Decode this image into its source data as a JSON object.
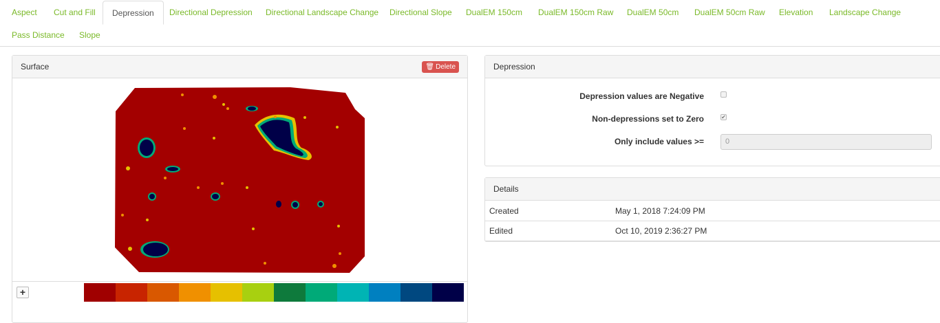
{
  "tabs": [
    {
      "label": "Aspect",
      "active": false
    },
    {
      "label": "Cut and Fill",
      "active": false
    },
    {
      "label": "Depression",
      "active": true
    },
    {
      "label": "Directional Depression",
      "active": false
    },
    {
      "label": "Directional Landscape Change",
      "active": false
    },
    {
      "label": "Directional Slope",
      "active": false
    },
    {
      "label": "DualEM 150cm",
      "active": false
    },
    {
      "label": "DualEM 150cm Raw",
      "active": false
    },
    {
      "label": "DualEM 50cm",
      "active": false
    },
    {
      "label": "DualEM 50cm Raw",
      "active": false
    },
    {
      "label": "Elevation",
      "active": false
    },
    {
      "label": "Landscape Change",
      "active": false
    },
    {
      "label": "Pass Distance",
      "active": false
    },
    {
      "label": "Slope",
      "active": false
    }
  ],
  "surface_panel": {
    "title": "Surface",
    "delete_label": "Delete",
    "legend_colors": [
      "#a00000",
      "#c82400",
      "#d95800",
      "#f09000",
      "#e6c000",
      "#a8d010",
      "#0e7a3c",
      "#00aa78",
      "#00b4b4",
      "#0080c0",
      "#004880",
      "#000048"
    ]
  },
  "depression_panel": {
    "title": "Depression",
    "negative_label": "Depression values are Negative",
    "negative_checked": false,
    "zero_label": "Non-depressions set to Zero",
    "zero_checked": true,
    "threshold_label": "Only include values >=",
    "threshold_value": "0"
  },
  "details_panel": {
    "title": "Details",
    "rows": [
      {
        "key": "Created",
        "value": "May 1, 2018 7:24:09 PM"
      },
      {
        "key": "Edited",
        "value": "Oct 10, 2019 2:36:27 PM"
      }
    ]
  }
}
